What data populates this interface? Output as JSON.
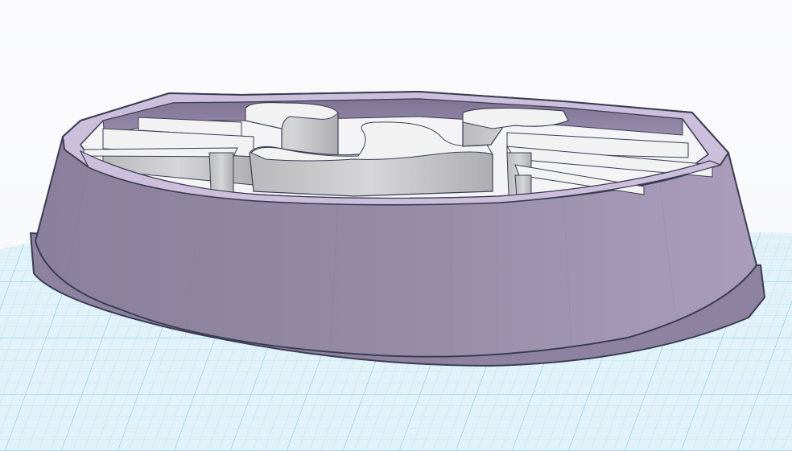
{
  "app": {
    "view": "3d-workplane",
    "model": "oval-tray-with-dividers"
  },
  "colors": {
    "background": "#f7f8fb",
    "grid_fill": "#ddeff7",
    "grid_line": "#b8dcec",
    "grid_major": "#8fc6e0",
    "body_purple": "#958aa6",
    "body_purple_light": "#b7abc9",
    "rim_top": "#cbbfdc",
    "outline": "#3a3d52",
    "divider_face": "#c9c9cb",
    "divider_top": "#f2f2f3",
    "cavity_floor": "#f4f4f6",
    "inner_wall": "#8a7f9c"
  },
  "icons": {
    "workplane": "grid-workplane-icon",
    "shape": "tray-shape"
  }
}
